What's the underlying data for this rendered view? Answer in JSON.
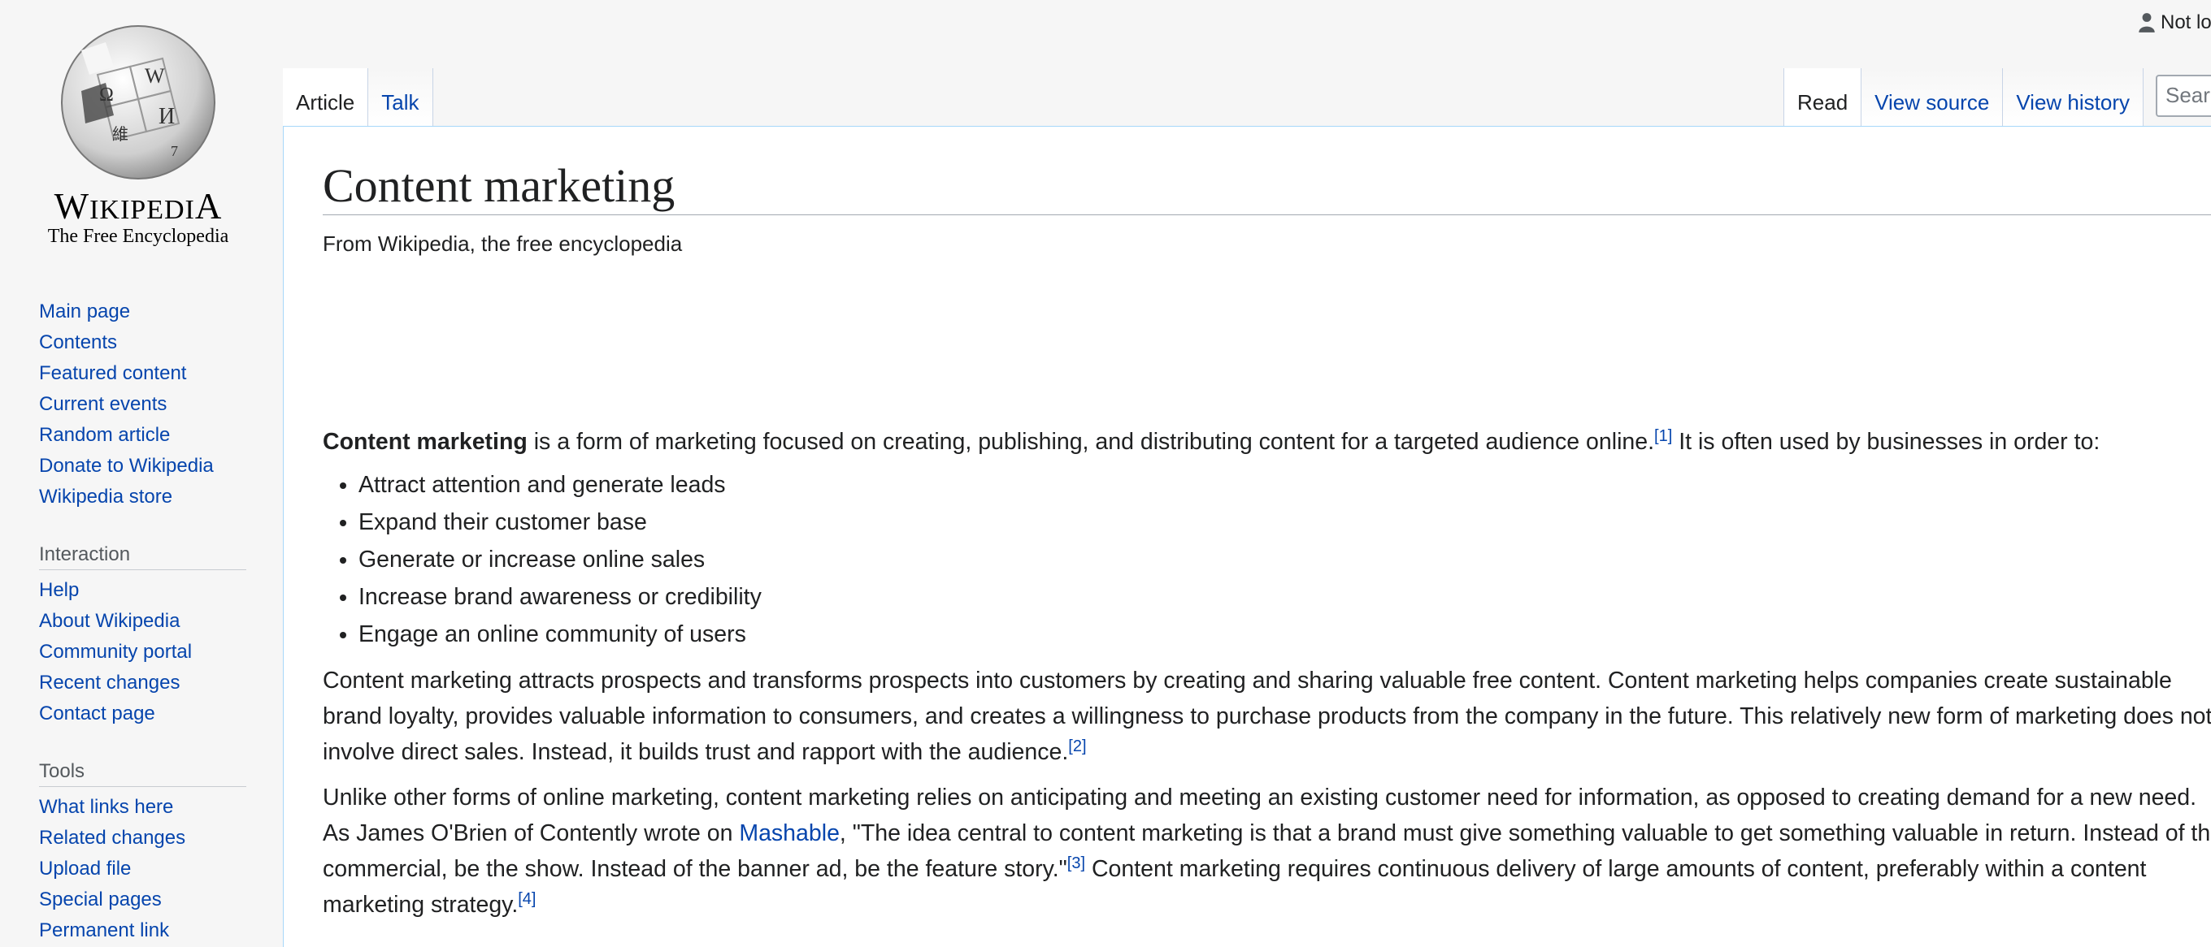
{
  "personal": {
    "label": "Not logged in"
  },
  "logo": {
    "wordmark": "Wikipedia",
    "tagline": "The Free Encyclopedia"
  },
  "sidebar": {
    "navigation": [
      {
        "label": "Main page"
      },
      {
        "label": "Contents"
      },
      {
        "label": "Featured content"
      },
      {
        "label": "Current events"
      },
      {
        "label": "Random article"
      },
      {
        "label": "Donate to Wikipedia"
      },
      {
        "label": "Wikipedia store"
      }
    ],
    "interaction": {
      "heading": "Interaction",
      "items": [
        {
          "label": "Help"
        },
        {
          "label": "About Wikipedia"
        },
        {
          "label": "Community portal"
        },
        {
          "label": "Recent changes"
        },
        {
          "label": "Contact page"
        }
      ]
    },
    "tools": {
      "heading": "Tools",
      "items": [
        {
          "label": "What links here"
        },
        {
          "label": "Related changes"
        },
        {
          "label": "Upload file"
        },
        {
          "label": "Special pages"
        },
        {
          "label": "Permanent link"
        }
      ]
    }
  },
  "tabs": {
    "left": [
      {
        "label": "Article"
      },
      {
        "label": "Talk"
      }
    ],
    "right": [
      {
        "label": "Read"
      },
      {
        "label": "View source"
      },
      {
        "label": "View history"
      }
    ]
  },
  "search": {
    "placeholder": "Search Wikipedia"
  },
  "article": {
    "title": "Content marketing",
    "subtitle": "From Wikipedia, the free encyclopedia",
    "p1": {
      "bold": "Content marketing",
      "text": " is a form of marketing focused on creating, publishing, and distributing content for a targeted audience online.",
      "ref1": "[1]",
      "text2": " It is often used by businesses in order to:"
    },
    "bullets": [
      "Attract attention and generate leads",
      "Expand their customer base",
      "Generate or increase online sales",
      "Increase brand awareness or credibility",
      "Engage an online community of users"
    ],
    "p2": {
      "text": "Content marketing attracts prospects and transforms prospects into customers by creating and sharing valuable free content. Content marketing helps companies create sustainable brand loyalty, provides valuable information to consumers, and creates a willingness to purchase products from the company in the future. This relatively new form of marketing does not involve direct sales. Instead, it builds trust and rapport with the audience.",
      "ref": "[2]"
    },
    "p3": {
      "text1": "Unlike other forms of online marketing, content marketing relies on anticipating and meeting an existing customer need for information, as opposed to creating demand for a new need. As James O'Brien of Contently wrote on ",
      "link": "Mashable",
      "text2": ", \"The idea central to content marketing is that a brand must give something valuable to get something valuable in return. Instead of the commercial, be the show. Instead of the banner ad, be the feature story.\"",
      "ref3": "[3]",
      "text3": " Content marketing requires continuous delivery of large amounts of content, preferably within a content marketing strategy.",
      "ref4": "[4]"
    }
  },
  "colors": {
    "link": "#0645ad",
    "text": "#202122",
    "border": "#a7d7f9"
  }
}
